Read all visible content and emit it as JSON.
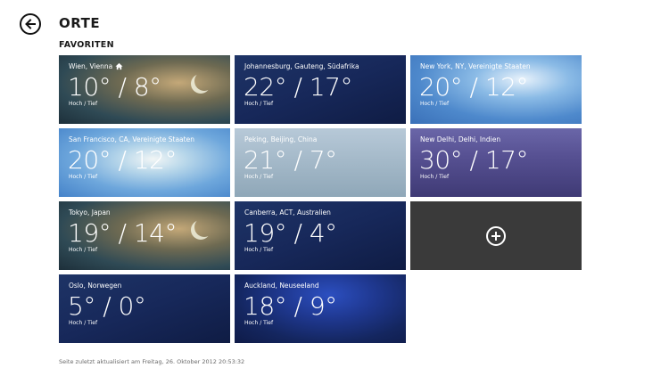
{
  "header": {
    "title": "ORTE",
    "section": "FAVORITEN"
  },
  "tiles": [
    {
      "city": "Wien, Vienna",
      "temps": "10° / 8°",
      "hl": "Hoch / Tief",
      "home": true
    },
    {
      "city": "Johannesburg, Gauteng, Südafrika",
      "temps": "22° / 17°",
      "hl": "Hoch / Tief"
    },
    {
      "city": "New York, NY, Vereinigte Staaten",
      "temps": "20° / 12°",
      "hl": "Hoch / Tief"
    },
    {
      "city": "San Francisco, CA, Vereinigte Staaten",
      "temps": "20° / 12°",
      "hl": "Hoch / Tief"
    },
    {
      "city": "Peking, Beijing, China",
      "temps": "21° / 7°",
      "hl": "Hoch / Tief"
    },
    {
      "city": "New Delhi, Delhi, Indien",
      "temps": "30° / 17°",
      "hl": "Hoch / Tief"
    },
    {
      "city": "Tokyo, Japan",
      "temps": "19° / 14°",
      "hl": "Hoch / Tief"
    },
    {
      "city": "Canberra, ACT, Australien",
      "temps": "19° / 4°",
      "hl": "Hoch / Tief"
    },
    {
      "city": "Oslo, Norwegen",
      "temps": "5° / 0°",
      "hl": "Hoch / Tief"
    },
    {
      "city": "Auckland, Neuseeland",
      "temps": "18° / 9°",
      "hl": "Hoch / Tief"
    }
  ],
  "footer": {
    "text": "Seite zuletzt aktualisiert am Freitag, 26. Oktober 2012 20:53:32"
  },
  "icons": {
    "back": "back-arrow-icon",
    "home": "home-icon",
    "add": "add-circle-icon"
  }
}
